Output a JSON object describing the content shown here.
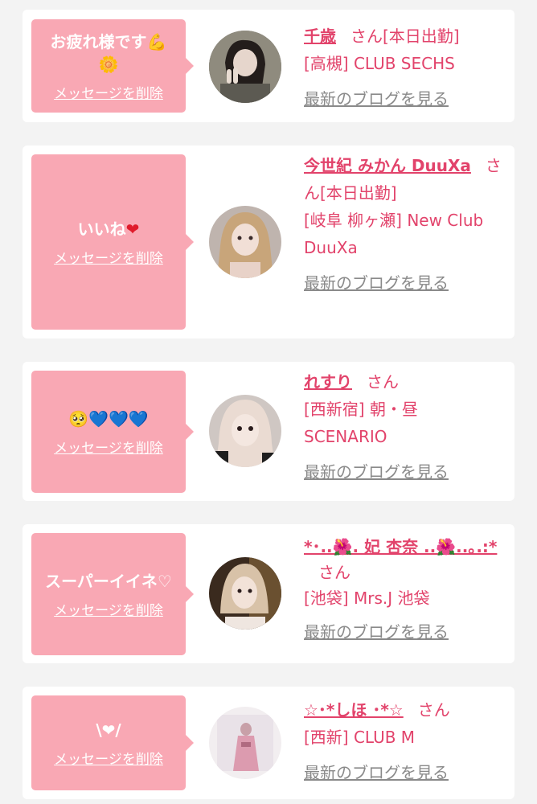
{
  "delete_label": "メッセージを削除",
  "san_label": "さん",
  "blog_label": "最新のブログを見る",
  "colors": {
    "bubble": "#f9a8b4",
    "accent": "#e2436b",
    "link_gray": "#8a8a8a"
  },
  "items": [
    {
      "message": "お疲れ様です",
      "message_emoji": "💪 🌼",
      "name": "千歳",
      "status": "[本日出勤]",
      "shop": "[高槻] CLUB SECHS",
      "avatar_icon": "woman-peace-sign-avatar"
    },
    {
      "message": "いいね",
      "message_emoji": "❤",
      "name": "今世紀 みかん DuuXa",
      "status": "[本日出勤]",
      "shop": "[岐阜 柳ヶ瀬] New Club DuuXa",
      "avatar_icon": "woman-twin-tails-avatar"
    },
    {
      "message": "",
      "message_emoji": "🥺💙💙💙",
      "name": "れすり",
      "status": "",
      "shop": "[西新宿] 朝・昼 SCENARIO",
      "avatar_icon": "woman-blonde-avatar"
    },
    {
      "message": "スーパーイイネ♡",
      "message_emoji": "",
      "name": "*･..🌺. 妃 杏奈 ..🌺..｡.:*",
      "status": "",
      "shop": "[池袋] Mrs.J 池袋",
      "avatar_icon": "woman-selfie-avatar"
    },
    {
      "message": "\\❤/",
      "message_emoji": "",
      "name": "☆･*しほ ･*☆",
      "status": "",
      "shop": "[西新] CLUB M",
      "avatar_icon": "woman-kimono-avatar"
    }
  ]
}
